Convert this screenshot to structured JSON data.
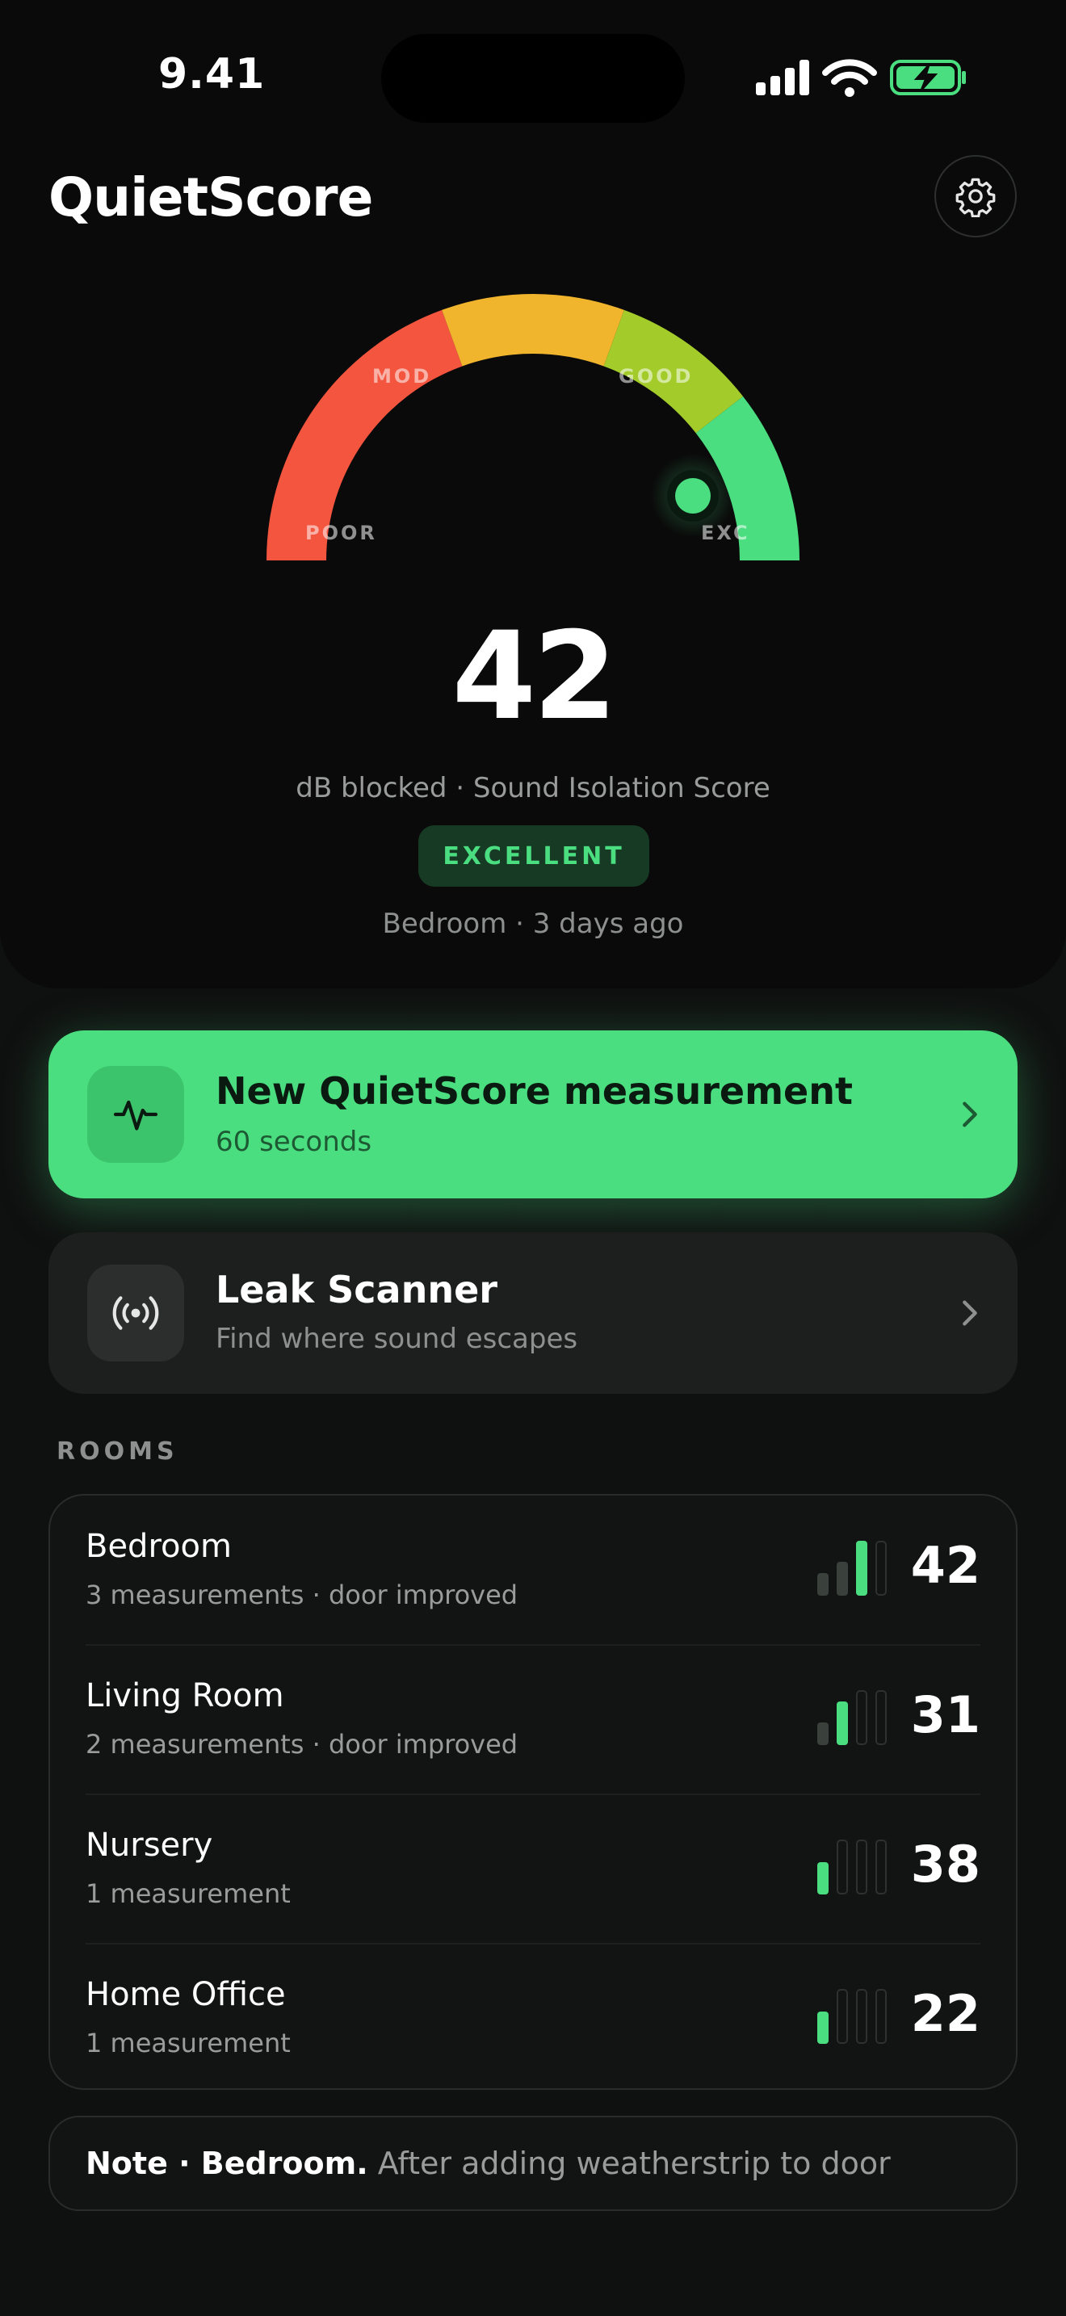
{
  "status_bar": {
    "time": "9.41"
  },
  "header": {
    "title": "QuietScore"
  },
  "gauge": {
    "labels": {
      "poor": "POOR",
      "mod": "MOD",
      "good": "GOOD",
      "exc": "EXC"
    },
    "score": "42",
    "caption": "dB blocked · Sound Isolation Score",
    "badge": "EXCELLENT",
    "last_measured": "Bedroom · 3 days ago",
    "colors": {
      "poor": "#f4553f",
      "mod": "#f1b52d",
      "good": "#a3cc2b",
      "exc": "#4ade80"
    }
  },
  "actions": {
    "primary": {
      "title": "New QuietScore measurement",
      "subtitle": "60 seconds",
      "icon": "pulse-icon"
    },
    "secondary": {
      "title": "Leak Scanner",
      "subtitle": "Find where sound escapes",
      "icon": "broadcast-icon"
    }
  },
  "rooms": {
    "header": "ROOMS",
    "items": [
      {
        "name": "Bedroom",
        "meta": "3 measurements · door improved",
        "score": "42",
        "level": 3
      },
      {
        "name": "Living Room",
        "meta": "2 measurements · door improved",
        "score": "31",
        "level": 2
      },
      {
        "name": "Nursery",
        "meta": "1 measurement",
        "score": "38",
        "level": 1
      },
      {
        "name": "Home Office",
        "meta": "1 measurement",
        "score": "22",
        "level": 1
      }
    ]
  },
  "note": {
    "prefix": "Note · Bedroom.",
    "text": " After adding weatherstrip to door"
  },
  "accent_color": "#4ade80"
}
